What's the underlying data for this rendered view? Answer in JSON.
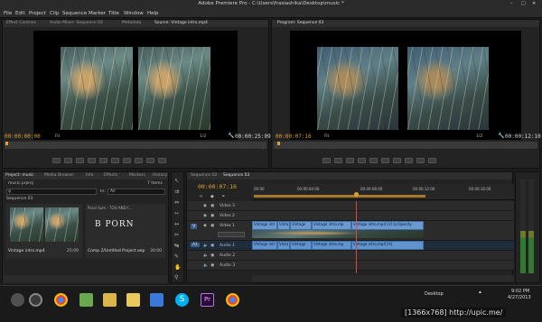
{
  "app": {
    "title": "Adobe Premiere Pro - C:\\Users\\frasiashika\\Desktop\\music *"
  },
  "menu": [
    "File",
    "Edit",
    "Project",
    "Clip",
    "Sequence",
    "Marker",
    "Title",
    "Window",
    "Help"
  ],
  "source_panel": {
    "tabs": [
      "Effect Controls",
      "Audio Mixer: Sequence 03",
      "Metadata",
      "Source: Vintage intro.mp4"
    ],
    "timecode_left": "00:00:00:00",
    "fit": "Fit",
    "resolution": "1/2",
    "timecode_right": "00:00:25:09"
  },
  "program_panel": {
    "tabs": [
      "Program: Sequence 03"
    ],
    "timecode_left": "00:00:07:16",
    "fit": "Fit",
    "resolution": "1/2",
    "timecode_right": "00:00:12:10"
  },
  "project_panel": {
    "tabs": [
      "Project: music",
      "Media Browser",
      "Info",
      "Effects",
      "Markers",
      "History"
    ],
    "project_file": "music.prproj",
    "item_count": "7 Items",
    "search_in_label": "In:",
    "search_in_value": "All",
    "sequence_label": "Sequence 03",
    "items": [
      {
        "name": "Vintage intro.mp4",
        "duration": "25:09"
      },
      {
        "name": "Comp 2/Untitled Project.aep",
        "duration": "30:00"
      }
    ],
    "comp_header": "B PORN",
    "comp_tooltip": "Rival Sum - TOU AND I..."
  },
  "timeline_panel": {
    "tabs": [
      "Sequence 02",
      "Sequence 03"
    ],
    "timecode": "00:00:07:16",
    "ruler": [
      "00:00",
      "00:00:04:00",
      "00:00:08:00",
      "00:00:12:00",
      "00:00:16:00"
    ],
    "video_tracks": [
      "Video 3",
      "Video 2",
      "Video 1"
    ],
    "audio_tracks": [
      "Audio 1",
      "Audio 2",
      "Audio 3"
    ],
    "v_target": "V",
    "a_target": "A1",
    "video_clips": [
      "Vintage intr",
      "Vinta",
      "Vintage",
      "Vintage intro.mp",
      "Vintage intro.mp4 [V] ty:Opacity -"
    ],
    "audio_clips": [
      "Vintage intr",
      "Vinta",
      "Vintage",
      "Vintage intro.mp",
      "Vintage intro.mp4 [A]"
    ]
  },
  "taskbar": {
    "language": "Desktop",
    "time": "9:02 PM",
    "date": "4/27/2013",
    "watermark": "[1366x768] http://upic.me/"
  },
  "colors": {
    "timecode": "#e0a02a",
    "clip": "#6b9ad2",
    "playhead": "#d94a3a"
  }
}
